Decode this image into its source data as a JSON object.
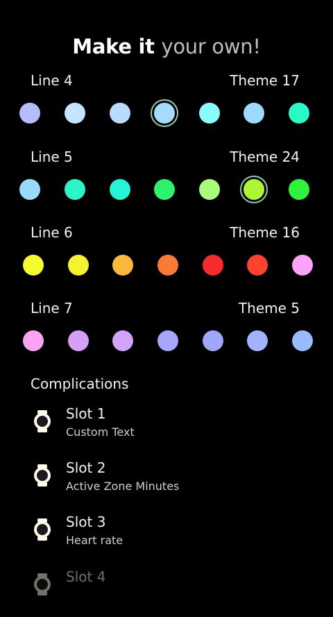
{
  "header": {
    "title_part1": "Make it",
    "title_part2": "your own!"
  },
  "lines": [
    {
      "label": "Line 4",
      "theme": "Theme 17",
      "selected_index": 3,
      "colors": [
        "#b3bdfc",
        "#c3e6fe",
        "#b7dcfd",
        "#a7dbfd",
        "#8afcfc",
        "#9bdcfe",
        "#2afbc6"
      ]
    },
    {
      "label": "Line 5",
      "theme": "Theme 24",
      "selected_index": 5,
      "colors": [
        "#98dcfd",
        "#2cf5c8",
        "#22f5d8",
        "#2cf36d",
        "#aafb7a",
        "#aef535",
        "#2ff23b"
      ]
    },
    {
      "label": "Line 6",
      "theme": "Theme 16",
      "selected_index": -1,
      "colors": [
        "#f4fb2f",
        "#f3f42e",
        "#fbb83c",
        "#fb7a36",
        "#f72a2e",
        "#fb432d",
        "#fba3f8"
      ]
    },
    {
      "label": "Line 7",
      "theme": "Theme 5",
      "selected_index": -1,
      "colors": [
        "#fba3f2",
        "#d49ff5",
        "#d2a3fb",
        "#a6a7fb",
        "#a0a6fb",
        "#a1b3fb",
        "#98bcfb"
      ]
    }
  ],
  "complications": {
    "title": "Complications",
    "slots": [
      {
        "name": "Slot 1",
        "value": "Custom Text"
      },
      {
        "name": "Slot 2",
        "value": "Active Zone Minutes"
      },
      {
        "name": "Slot 3",
        "value": "Heart rate"
      },
      {
        "name": "Slot 4",
        "value": ""
      }
    ]
  },
  "icons": {
    "slot_icon": "watch-icon",
    "accent_ring": "#8ecfb7",
    "watch_body": "#fffbe8"
  }
}
